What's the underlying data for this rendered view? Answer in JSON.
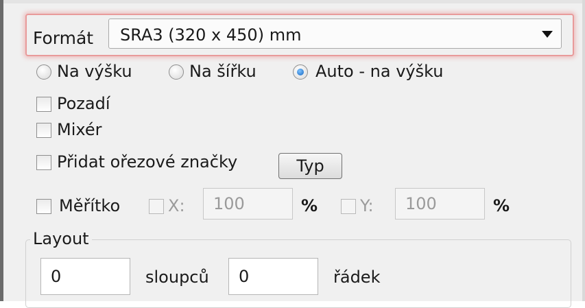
{
  "format": {
    "label": "Formát",
    "selected": "SRA3 (320 x 450) mm"
  },
  "orientation": {
    "options": [
      {
        "label": "Na výšku",
        "checked": false
      },
      {
        "label": "Na šířku",
        "checked": false
      },
      {
        "label": "Auto - na výšku",
        "checked": true
      }
    ]
  },
  "checkboxes": {
    "background": {
      "label": "Pozadí",
      "checked": false
    },
    "mixer": {
      "label": "Mixér",
      "checked": false
    },
    "crop_marks": {
      "label": "Přidat ořezové značky",
      "checked": false
    }
  },
  "type_button": {
    "label": "Typ"
  },
  "scale": {
    "label": "Měřítko",
    "checked": false,
    "x": {
      "label": "X:",
      "value": "100",
      "unit": "%"
    },
    "y": {
      "label": "Y:",
      "value": "100",
      "unit": "%"
    }
  },
  "layout": {
    "title": "Layout",
    "columns": {
      "value": "0",
      "label": "sloupců"
    },
    "rows": {
      "value": "0",
      "label": "řádek"
    }
  }
}
